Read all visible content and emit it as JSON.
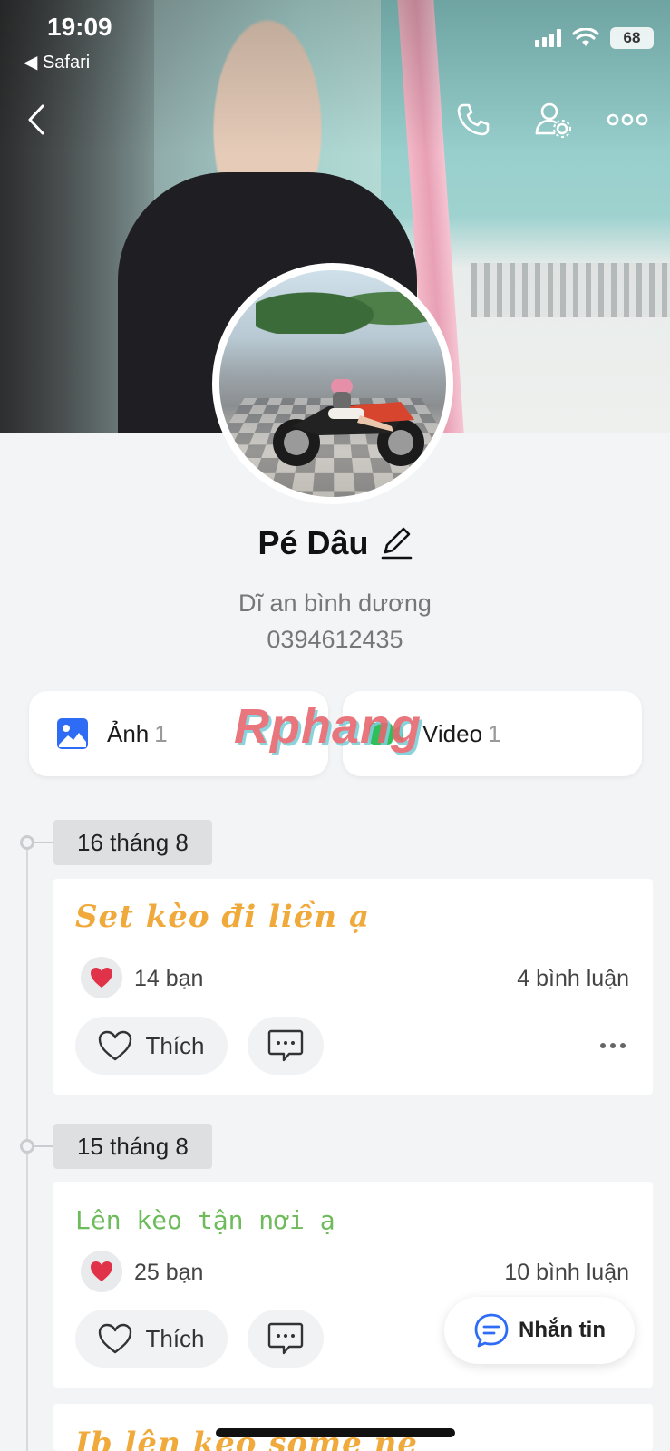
{
  "status_bar": {
    "time": "19:09",
    "back_app": "◀ Safari",
    "battery": "68"
  },
  "top_nav": {
    "icons": [
      "back-icon",
      "phone-icon",
      "user-settings-icon",
      "more-icon"
    ]
  },
  "profile": {
    "name": "Pé Dâu",
    "location": "Dĩ an bình dương",
    "phone": "0394612435"
  },
  "media": [
    {
      "label": "Ảnh",
      "count": "1",
      "icon": "photo-icon",
      "color": "#2f6cf6"
    },
    {
      "label": "Video",
      "count": "1",
      "icon": "video-icon",
      "color": "#2fbf5a"
    }
  ],
  "watermark": "Rphang",
  "posts": [
    {
      "date": "16 tháng 8",
      "text": "Set kèo đi liền ạ",
      "reactions": "14 bạn",
      "comments": "4 bình luận",
      "like_label": "Thích"
    },
    {
      "date": "15 tháng 8",
      "text": "Lên kèo tận nơi ạ",
      "reactions": "25 bạn",
      "comments": "10 bình luận",
      "like_label": "Thích"
    },
    {
      "text": "Ib lên kèo some nè"
    }
  ],
  "fab": {
    "label": "Nhắn tin"
  },
  "colors": {
    "accent": "#2f6cf6",
    "post_orange": "#f0a93b",
    "post_green": "#6dbb5a",
    "heart": "#e0334a"
  }
}
